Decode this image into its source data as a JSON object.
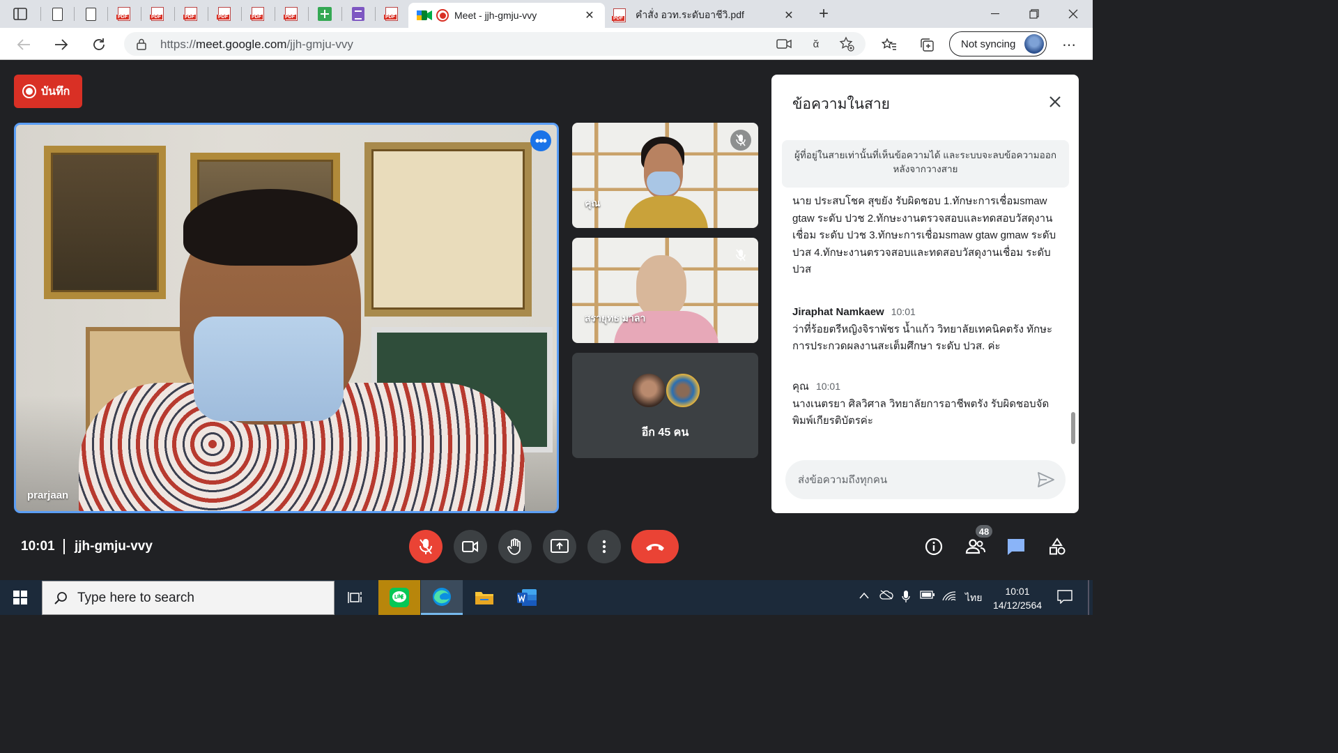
{
  "browser": {
    "active_tab": {
      "title": "Meet - jjh-gmju-vvy"
    },
    "second_tab": {
      "title": "คำสั่ง อวท.ระดับอาชีวิ.pdf"
    },
    "url": {
      "scheme_host": "https://",
      "host": "meet.google.com",
      "path": "/jjh-gmju-vvy"
    },
    "profile_label": "Not syncing"
  },
  "meet": {
    "record_label": "บันทึก",
    "main_speaker": "prarjaan",
    "tiles": [
      {
        "name": "คุณ"
      },
      {
        "name": "สรายุทธ มาลา"
      }
    ],
    "more_label": "อีก 45 คน",
    "time": "10:01",
    "meeting_code": "jjh-gmju-vvy",
    "participants_count": "48"
  },
  "chat": {
    "title": "ข้อความในสาย",
    "notice": "ผู้ที่อยู่ในสายเท่านั้นที่เห็นข้อความได้ และระบบจะลบข้อความออกหลังจากวางสาย",
    "messages": [
      {
        "sender": "",
        "time": "",
        "text": "นาย ประสบโชค สุขยัง รับผิดชอบ 1.ทักษะการเชื่อมsmaw gtaw ระดับ ปวช 2.ทักษะงานตรวจสอบและทดสอบวัสดุงานเชื่อม ระดับ ปวช 3.ทักษะการเชื่อมsmaw gtaw gmaw ระดับ ปวส 4.ทักษะงานตรวจสอบและทดสอบวัสดุงานเชื่อม ระดับ ปวส"
      },
      {
        "sender": "Jiraphat Namkaew",
        "time": "10:01",
        "text": "ว่าที่ร้อยตรีหญิงจิราพัชร น้ำแก้ว วิทยาลัยเทคนิคตรัง ทักษะการประกวดผลงานสะเต็มศึกษา ระดับ ปวส. ค่ะ"
      },
      {
        "sender": "คุณ",
        "time": "10:01",
        "text": "นางเนตรยา ศิลวิศาล วิทยาลัยการอาชีพตรัง รับผิดชอบจัดพิมพ์เกียรติบัตรค่ะ"
      }
    ],
    "input_placeholder": "ส่งข้อความถึงทุกคน"
  },
  "taskbar": {
    "search_placeholder": "Type here to search",
    "lang": "ไทย",
    "clock_time": "10:01",
    "clock_date": "14/12/2564"
  },
  "colors": {
    "accent_blue": "#1a73e8",
    "hangup_red": "#ea4335",
    "meet_bg": "#202124"
  }
}
